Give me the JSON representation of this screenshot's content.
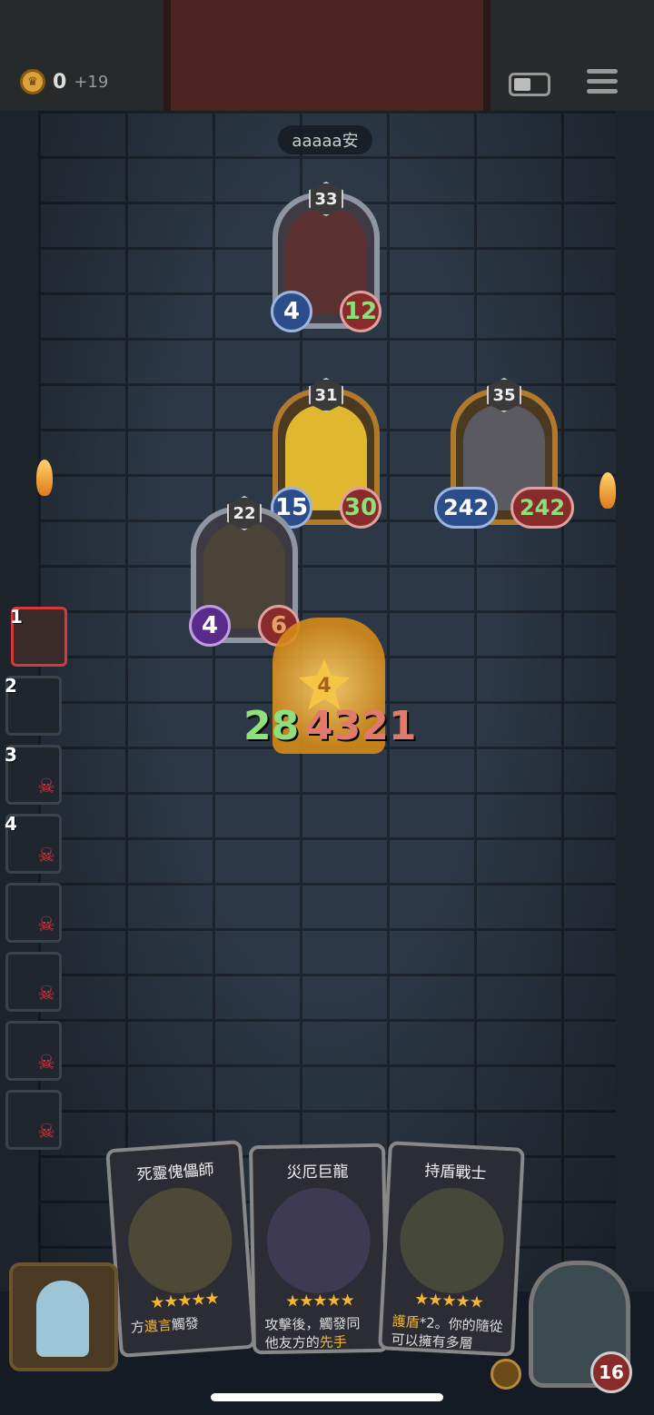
{
  "header": {
    "gold_count": "0",
    "gold_income": "+19",
    "icons": [
      "crown-coin-icon",
      "battery-icon",
      "menu-icon"
    ]
  },
  "opponent": {
    "name": "aaaaa安",
    "hero_health": "16"
  },
  "board_units": [
    {
      "tier": "33",
      "attack": "4",
      "health": "12",
      "frame": "silver"
    },
    {
      "tier": "31",
      "attack": "15",
      "health": "30",
      "frame": "gold"
    },
    {
      "tier": "35",
      "attack": "242",
      "health": "242",
      "frame": "gold"
    },
    {
      "tier": "22",
      "attack": "4",
      "health": "6",
      "frame": "silver"
    }
  ],
  "attacking_unit": {
    "tier": "4",
    "damage_left": "28",
    "damage_right": "4321"
  },
  "sidebar": {
    "slots": [
      {
        "num": "1",
        "status": "active"
      },
      {
        "num": "2",
        "status": "alive"
      },
      {
        "num": "3",
        "status": "defeated"
      },
      {
        "num": "4",
        "status": "defeated"
      },
      {
        "num": "",
        "status": "defeated"
      },
      {
        "num": "",
        "status": "defeated"
      },
      {
        "num": "",
        "status": "defeated"
      },
      {
        "num": "",
        "status": "defeated"
      }
    ]
  },
  "hand": {
    "cards": [
      {
        "name": "死靈傀儡師",
        "stars": "★★★★★",
        "desc_keyword": "遺言",
        "desc_pre": "方",
        "desc_post": "觸發"
      },
      {
        "name": "災厄巨龍",
        "stars": "★★★★★",
        "desc_line1": "攻擊後，觸發同",
        "desc_pre": "他友方的",
        "desc_keyword": "先手"
      },
      {
        "name": "持盾戰士",
        "stars": "★★★★★",
        "desc_keyword": "護盾",
        "desc_post": "*2。你的隨從",
        "desc_line2": "可以擁有多層"
      }
    ]
  },
  "colors": {
    "wall": "#2c3846",
    "accent_gold": "#f2b632",
    "health_green": "#8ee07a",
    "danger_red": "#e0303c"
  }
}
